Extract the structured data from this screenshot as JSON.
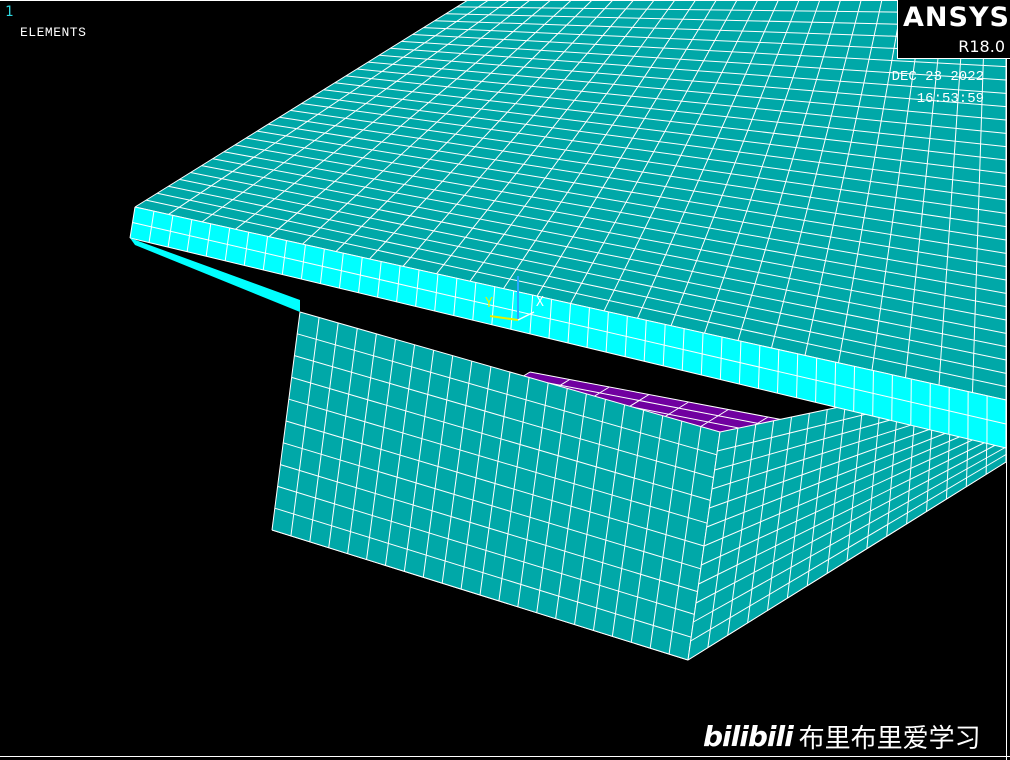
{
  "window": {
    "number": "1",
    "plot_label": "ELEMENTS"
  },
  "logo": {
    "name": "ANSYS",
    "version": "R18.0"
  },
  "timestamp": {
    "date": "DEC 23 2022",
    "time": "16:53:59"
  },
  "triad": {
    "y_label": "Y",
    "x_label": "X"
  },
  "watermark": {
    "brand": "bilibili",
    "text": "布里布里爱学习"
  },
  "colors": {
    "background": "#000000",
    "element_top": "#00a8a8",
    "element_edge": "#00ffff",
    "element_bottom": "#7000a0",
    "mesh_line": "#ffffff"
  }
}
